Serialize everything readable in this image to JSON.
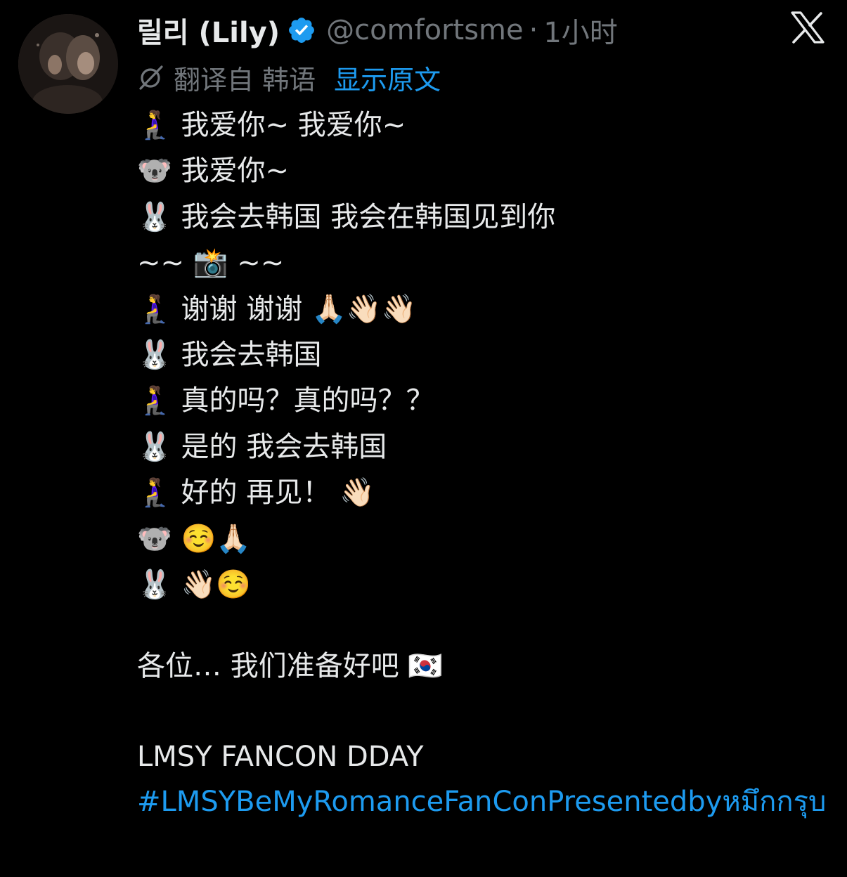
{
  "header": {
    "display_name": "릴리 (Lily)",
    "handle": "@comfortsme",
    "separator": "·",
    "timestamp": "1小时"
  },
  "translation": {
    "translated_from": "翻译自 韩语",
    "show_original": "显示原文"
  },
  "tweet": {
    "lines": [
      "🧎‍♀️ 我爱你~ 我爱你~",
      "🐨 我爱你~",
      "🐰 我会去韩国 我会在韩国见到你",
      "~~ 📸 ~~",
      "🧎‍♀️ 谢谢 谢谢 🙏🏻👋🏻👋🏻",
      "🐰 我会去韩国",
      "🧎‍♀️ 真的吗？真的吗？？",
      "🐰 是的 我会去韩国",
      "🧎‍♀️ 好的 再见！ 👋🏻",
      "🐨 ☺️🙏🏻",
      "🐰 👋🏻☺️"
    ],
    "closing": "各位… 我们准备好吧 🇰🇷",
    "event": "LMSY FANCON DDAY",
    "hashtag": "#LMSYBeMyRomanceFanConPresentedbyหมึกกรุบ"
  },
  "colors": {
    "background": "#000000",
    "text": "#e7e9ea",
    "secondary": "#71767b",
    "accent": "#1d9bf0"
  },
  "icons": {
    "verified": "verified-badge-icon",
    "logo": "x-logo-icon",
    "translate": "translate-icon"
  }
}
